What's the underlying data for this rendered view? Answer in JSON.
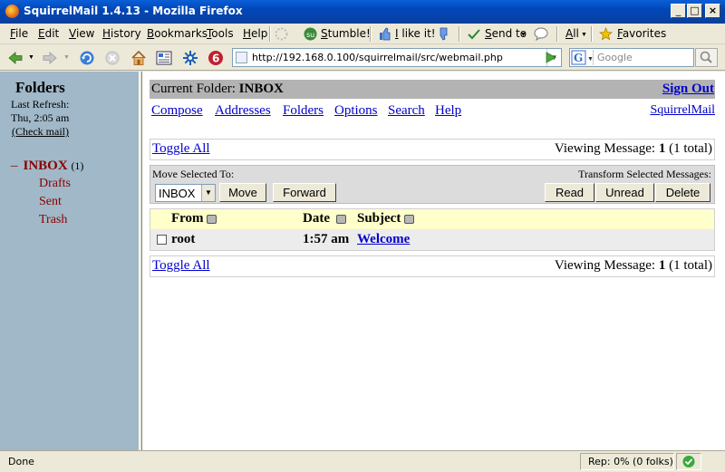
{
  "window": {
    "title": "SquirrelMail 1.4.13 - Mozilla Firefox",
    "minimize": "_",
    "maximize": "□",
    "close": "×"
  },
  "menu": [
    "File",
    "Edit",
    "View",
    "History",
    "Bookmarks",
    "Tools",
    "Help"
  ],
  "toolbar": {
    "stumble": "Stumble!",
    "ilike": "I like it!",
    "sendto": "Send to",
    "all": "All",
    "favorites": "Favorites"
  },
  "nav": {
    "url": "http://192.168.0.100/squirrelmail/src/webmail.php",
    "search_placeholder": "Google"
  },
  "left": {
    "title": "Folders",
    "last_refresh": "Last Refresh:",
    "refresh_time": "Thu, 2:05 am",
    "check_mail": "(Check mail)",
    "inbox_toggle": "–",
    "inbox": "INBOX",
    "inbox_count": "(1)",
    "folders": [
      "Drafts",
      "Sent",
      "Trash"
    ]
  },
  "main": {
    "current_folder_label": "Current Folder: ",
    "current_folder": "INBOX",
    "sign_out": "Sign Out",
    "nav_links": [
      "Compose",
      "Addresses",
      "Folders",
      "Options",
      "Search",
      "Help"
    ],
    "squirrelmail_link": "SquirrelMail",
    "toggle_all": "Toggle All",
    "viewing_prefix": "Viewing Message: ",
    "viewing_num": "1",
    "viewing_suffix": " (1 total)",
    "move_selected_to": "Move Selected To:",
    "transform_selected": "Transform Selected Messages:",
    "move_folder": "INBOX",
    "buttons": {
      "move": "Move",
      "forward": "Forward",
      "read": "Read",
      "unread": "Unread",
      "delete": "Delete"
    },
    "columns": {
      "from": "From",
      "date": "Date",
      "subject": "Subject"
    },
    "messages": [
      {
        "from": "root",
        "date": "1:57 am",
        "subject": "Welcome"
      }
    ]
  },
  "status": {
    "text": "Done",
    "rep": "Rep: 0% (0 folks)"
  }
}
